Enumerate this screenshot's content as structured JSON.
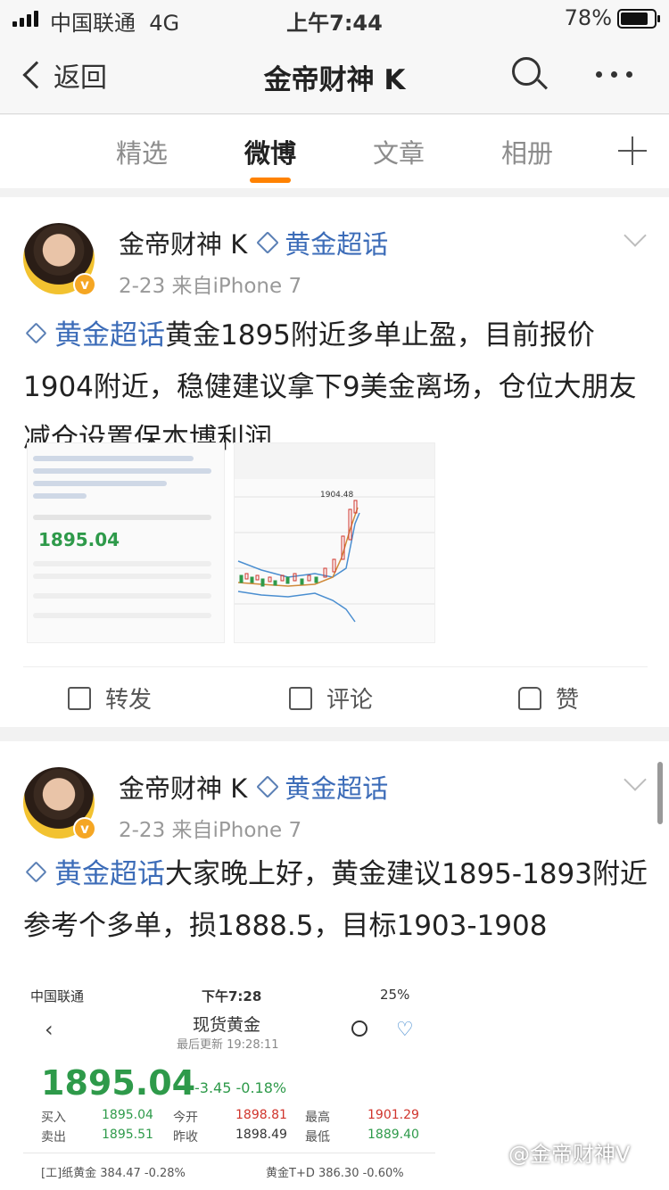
{
  "status_bar": {
    "carrier": "中国联通",
    "network": "4G",
    "time": "上午7:44",
    "battery": "78%"
  },
  "nav": {
    "back_label": "返回",
    "title": "金帝财神 K"
  },
  "tabs": [
    {
      "label": "精选"
    },
    {
      "label": "微博"
    },
    {
      "label": "文章"
    },
    {
      "label": "相册"
    }
  ],
  "posts": [
    {
      "user": "金帝财神 K",
      "topic": "黄金超话",
      "meta": "2-23  来自iPhone 7",
      "text_topic": "黄金超话",
      "text": "黄金1895附近多单止盈，目前报价1904附近，稳健建议拿下9美金离场，仓位大朋友减仓设置保本博利润",
      "thumb1_price": "1895.04",
      "thumb2_price": "1904.48",
      "actions": {
        "repost": "转发",
        "comment": "评论",
        "like": "赞"
      }
    },
    {
      "user": "金帝财神 K",
      "topic": "黄金超话",
      "meta": "2-23  来自iPhone 7",
      "text_topic": "黄金超话",
      "text": "大家晚上好，黄金建议1895-1893附近参考个多单，损1888.5，目标1903-1908"
    }
  ],
  "quote_screenshot": {
    "carrier": "中国联通",
    "time": "下午7:28",
    "battery": "25%",
    "title": "现货黄金",
    "updated": "最后更新 19:28:11",
    "price": "1895.04",
    "change": "-3.45  -0.18%",
    "buy_label": "买入",
    "buy": "1895.04",
    "sell_label": "卖出",
    "sell": "1895.51",
    "open_label": "今开",
    "open": "1898.81",
    "prev_label": "昨收",
    "prev": "1898.49",
    "high_label": "最高",
    "high": "1901.29",
    "low_label": "最低",
    "low": "1889.40",
    "paper_gold": "[工]纸黄金  384.47  -0.28%",
    "td_gold": "黄金T+D  386.30  -0.60%"
  },
  "watermark": "@金帝财神V",
  "colors": {
    "accent": "#ff8200",
    "topic": "#3c6cb8",
    "price_green": "#2e9a4a",
    "price_red": "#d0342c"
  }
}
